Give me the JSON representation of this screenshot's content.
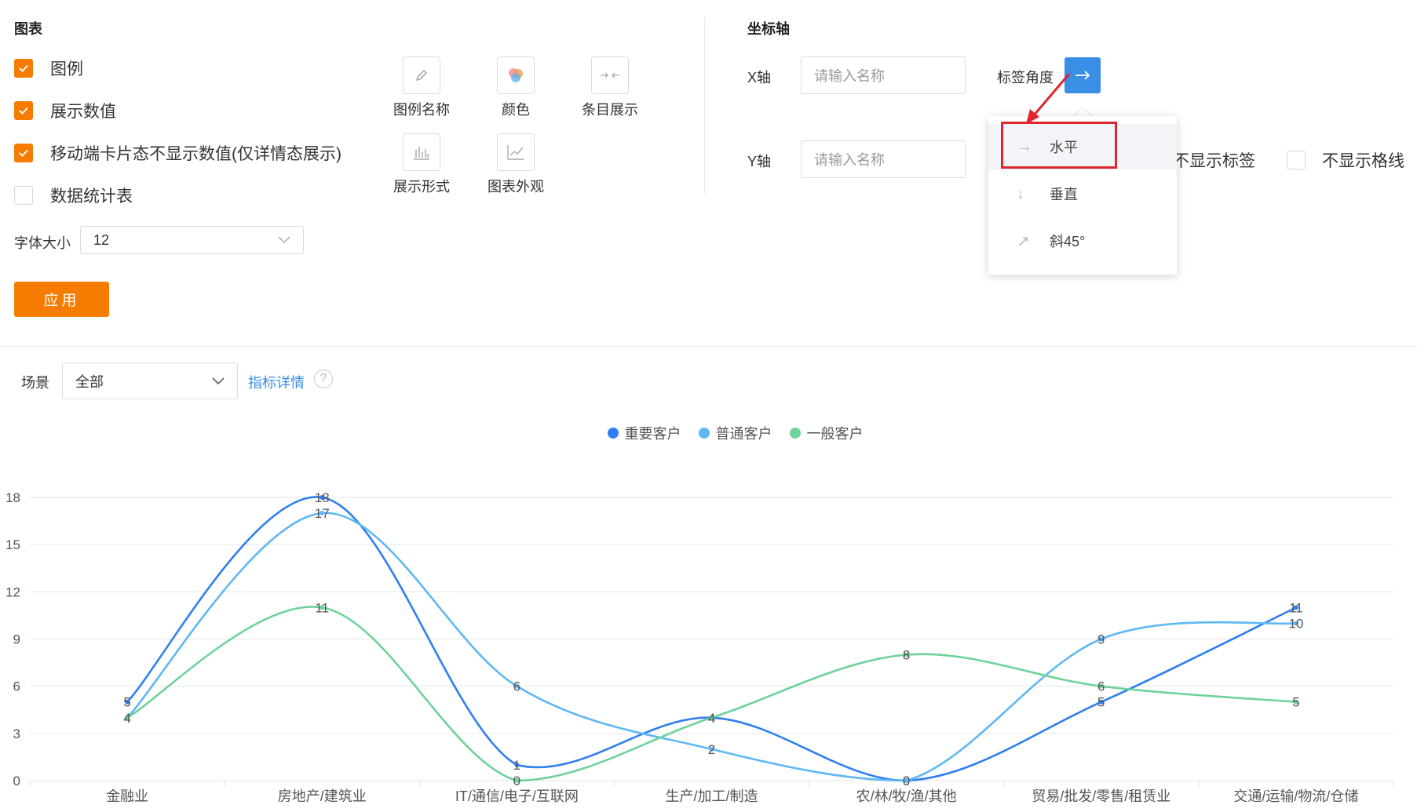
{
  "chart_panel": {
    "title": "图表",
    "checkboxes": [
      {
        "label": "图例",
        "checked": true
      },
      {
        "label": "展示数值",
        "checked": true
      },
      {
        "label": "移动端卡片态不显示数值(仅详情态展示)",
        "checked": true
      },
      {
        "label": "数据统计表",
        "checked": false
      }
    ],
    "font_size_label": "字体大小",
    "font_size_value": "12",
    "apply_label": "应用",
    "tools": [
      "图例名称",
      "颜色",
      "条目展示",
      "展示形式",
      "图表外观"
    ]
  },
  "axis_panel": {
    "title": "坐标轴",
    "x_label": "X轴",
    "y_label": "Y轴",
    "x_placeholder": "请输入名称",
    "y_placeholder": "请输入名称",
    "label_angle": "标签角度",
    "hide_labels": "不显示标签",
    "hide_gridlines": "不显示格线",
    "angle_options": [
      "水平",
      "垂直",
      "斜45°"
    ]
  },
  "filter": {
    "scene_label": "场景",
    "scene_value": "全部",
    "detail_link": "指标详情",
    "help_icon": "?"
  },
  "colors": {
    "accent": "#f57c00",
    "blue_button": "#3a8ee6",
    "highlight": "#e0262c"
  },
  "chart_data": {
    "type": "line",
    "smooth": true,
    "categories": [
      "金融业",
      "房地产/建筑业",
      "IT/通信/电子/互联网",
      "生产/加工/制造",
      "农/林/牧/渔/其他",
      "贸易/批发/零售/租赁业",
      "交通/运输/物流/仓储"
    ],
    "series": [
      {
        "name": "重要客户",
        "color": "#2f7ff0",
        "values": [
          5,
          18,
          1,
          4,
          0,
          5,
          11
        ]
      },
      {
        "name": "普通客户",
        "color": "#5fb8f5",
        "values": [
          4,
          17,
          6,
          2,
          0,
          9,
          10
        ]
      },
      {
        "name": "一般客户",
        "color": "#6ed29a",
        "values": [
          4,
          11,
          0,
          4,
          8,
          6,
          5
        ]
      }
    ],
    "yticks": [
      0,
      3,
      6,
      9,
      12,
      15,
      18
    ],
    "ylim": [
      0,
      18
    ],
    "legend_position": "top-center",
    "grid": true
  }
}
